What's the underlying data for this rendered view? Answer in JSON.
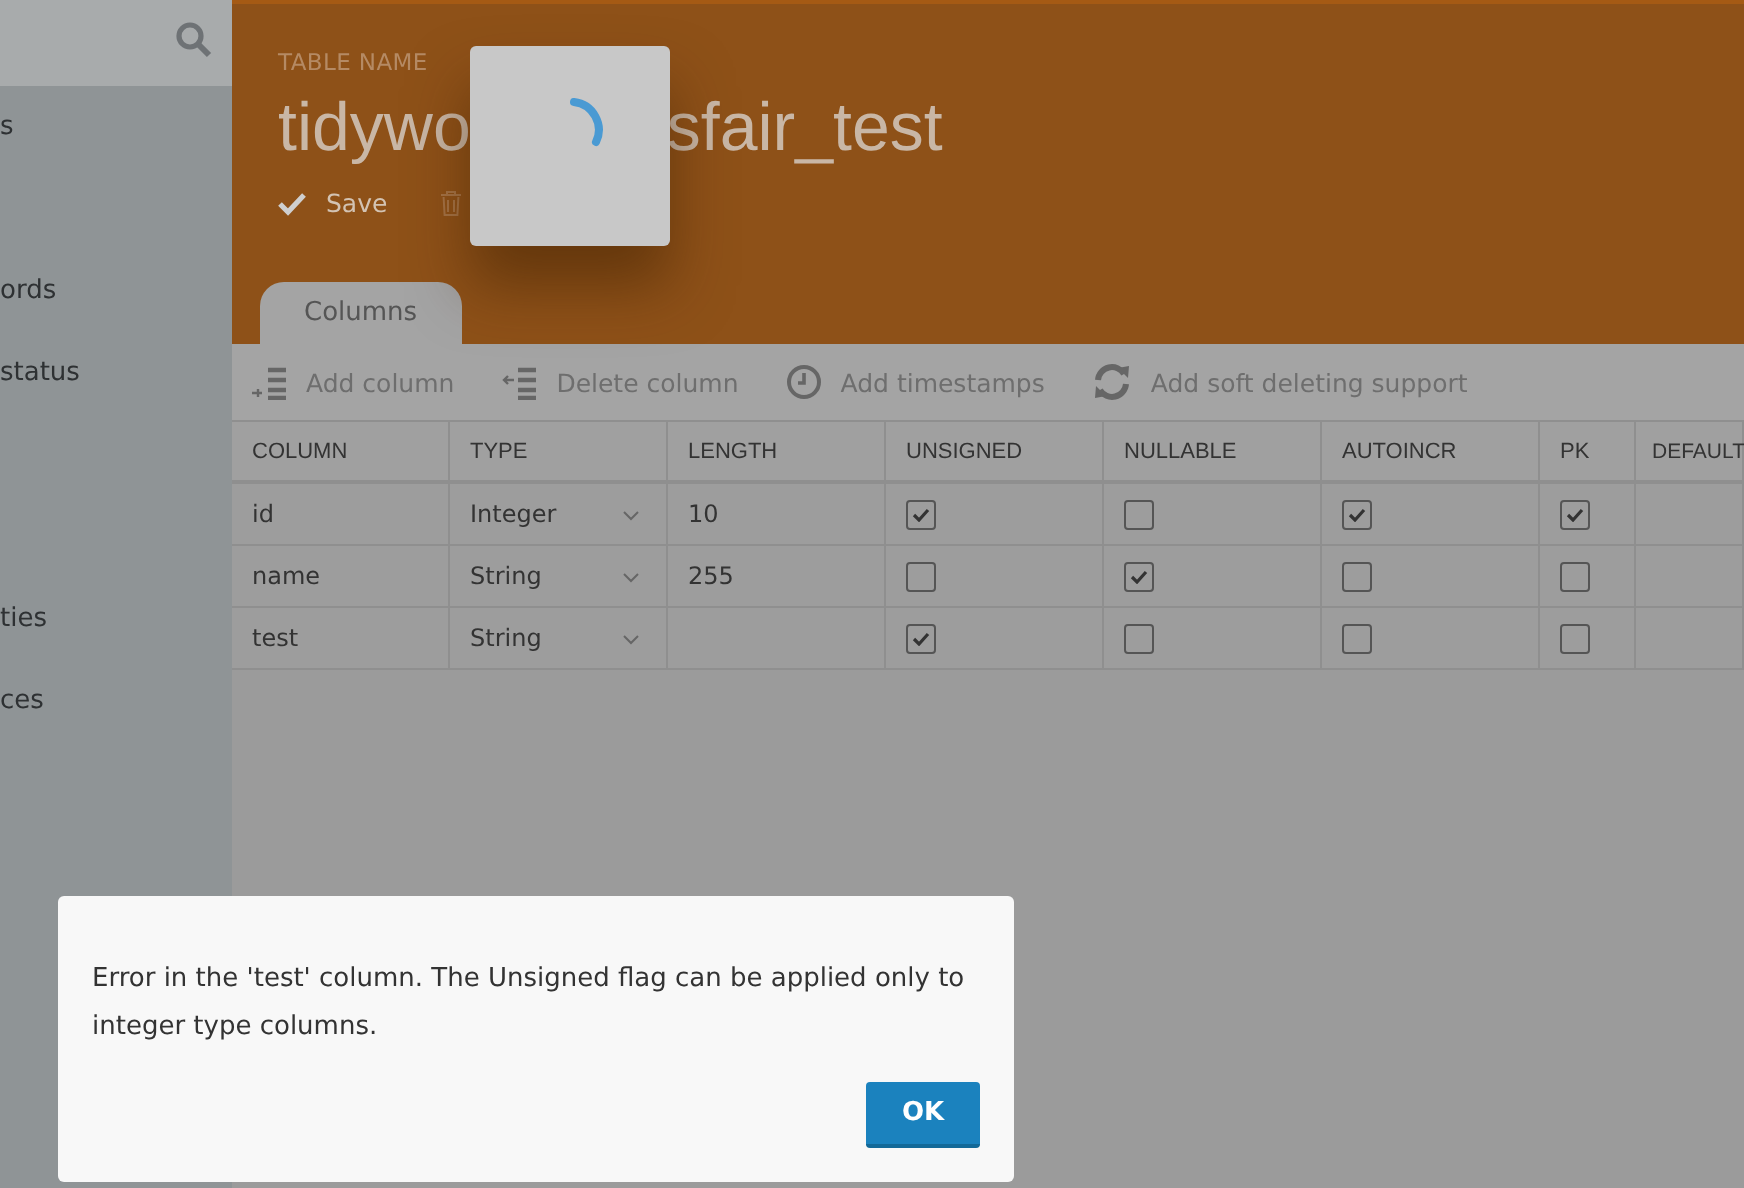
{
  "sidebar": {
    "items": [
      {
        "label": "s"
      },
      {
        "label": "ords"
      },
      {
        "label": "status"
      },
      {
        "label": "ties"
      },
      {
        "label": "ces"
      }
    ]
  },
  "header": {
    "label": "TABLE NAME",
    "title_start": "tidywo",
    "title_end": "sfair_test",
    "actions": [
      {
        "label": "Save",
        "kind": "save"
      },
      {
        "kind": "delete"
      }
    ]
  },
  "tabs": [
    {
      "label": "Columns",
      "selected": true
    }
  ],
  "toolbar": [
    {
      "label": "Add column",
      "kind": "add"
    },
    {
      "label": "Delete column",
      "kind": "delete"
    },
    {
      "label": "Add timestamps",
      "kind": "clock"
    },
    {
      "label": "Add soft deleting support",
      "kind": "refresh"
    }
  ],
  "table": {
    "columns": [
      "COLUMN",
      "TYPE",
      "LENGTH",
      "UNSIGNED",
      "NULLABLE",
      "AUTOINCR",
      "PK",
      "DEFAULT"
    ],
    "rows": [
      {
        "column": "id",
        "type": "Integer",
        "length": "10",
        "unsigned": true,
        "nullable": false,
        "autoincr": true,
        "pk": true
      },
      {
        "column": "name",
        "type": "String",
        "length": "255",
        "unsigned": false,
        "nullable": true,
        "autoincr": false,
        "pk": false
      },
      {
        "column": "test",
        "type": "String",
        "unsigned": true,
        "nullable": false,
        "autoincr": false,
        "pk": false
      }
    ]
  },
  "dialog": {
    "message": "Error in the 'test' column. The Unsigned flag can be applied only to integer type columns.",
    "button": "OK"
  }
}
